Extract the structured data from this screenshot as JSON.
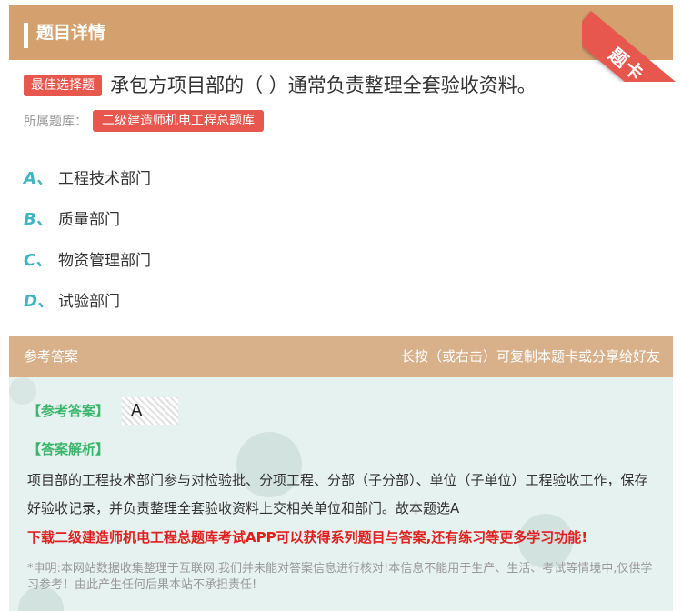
{
  "header": {
    "title": "题目详情"
  },
  "ribbon": {
    "label": "题卡"
  },
  "question": {
    "type_label": "最佳选择题",
    "text": "承包方项目部的（ ）通常负责整理全套验收资料。",
    "bank_label": "所属题库：",
    "bank_name": "二级建造师机电工程总题库"
  },
  "options": [
    {
      "letter": "A、",
      "text": "工程技术部门"
    },
    {
      "letter": "B、",
      "text": "质量部门"
    },
    {
      "letter": "C、",
      "text": "物资管理部门"
    },
    {
      "letter": "D、",
      "text": "试验部门"
    }
  ],
  "answer": {
    "section_label": "参考答案",
    "hint": "长按（或右击）可复制本题卡或分享给好友",
    "key_label": "【参考答案】",
    "key_value": "A",
    "analysis_label": "【答案解析】",
    "analysis_text": "项目部的工程技术部门参与对检验批、分项工程、分部（子分部）、单位（子单位）工程验收工作，保存好验收记录，并负责整理全套验收资料上交相关单位和部门。故本题选A",
    "promo": "下载二级建造师机电工程总题库考试APP可以获得系列题目与答案,还有练习等更多学习功能!",
    "disclaimer": "*申明:本网站数据收集整理于互联网,我们并未能对答案信息进行核对!本信息不能用于生产、生活、考试等情境中,仅供学习参考！由此产生任何后果本站不承担责任!"
  },
  "colors": {
    "header_bg": "#d4a06e",
    "accent_red": "#e8574d",
    "option_letter": "#3fb5c0",
    "answer_green": "#3bb56c",
    "promo_red": "#e02020"
  }
}
